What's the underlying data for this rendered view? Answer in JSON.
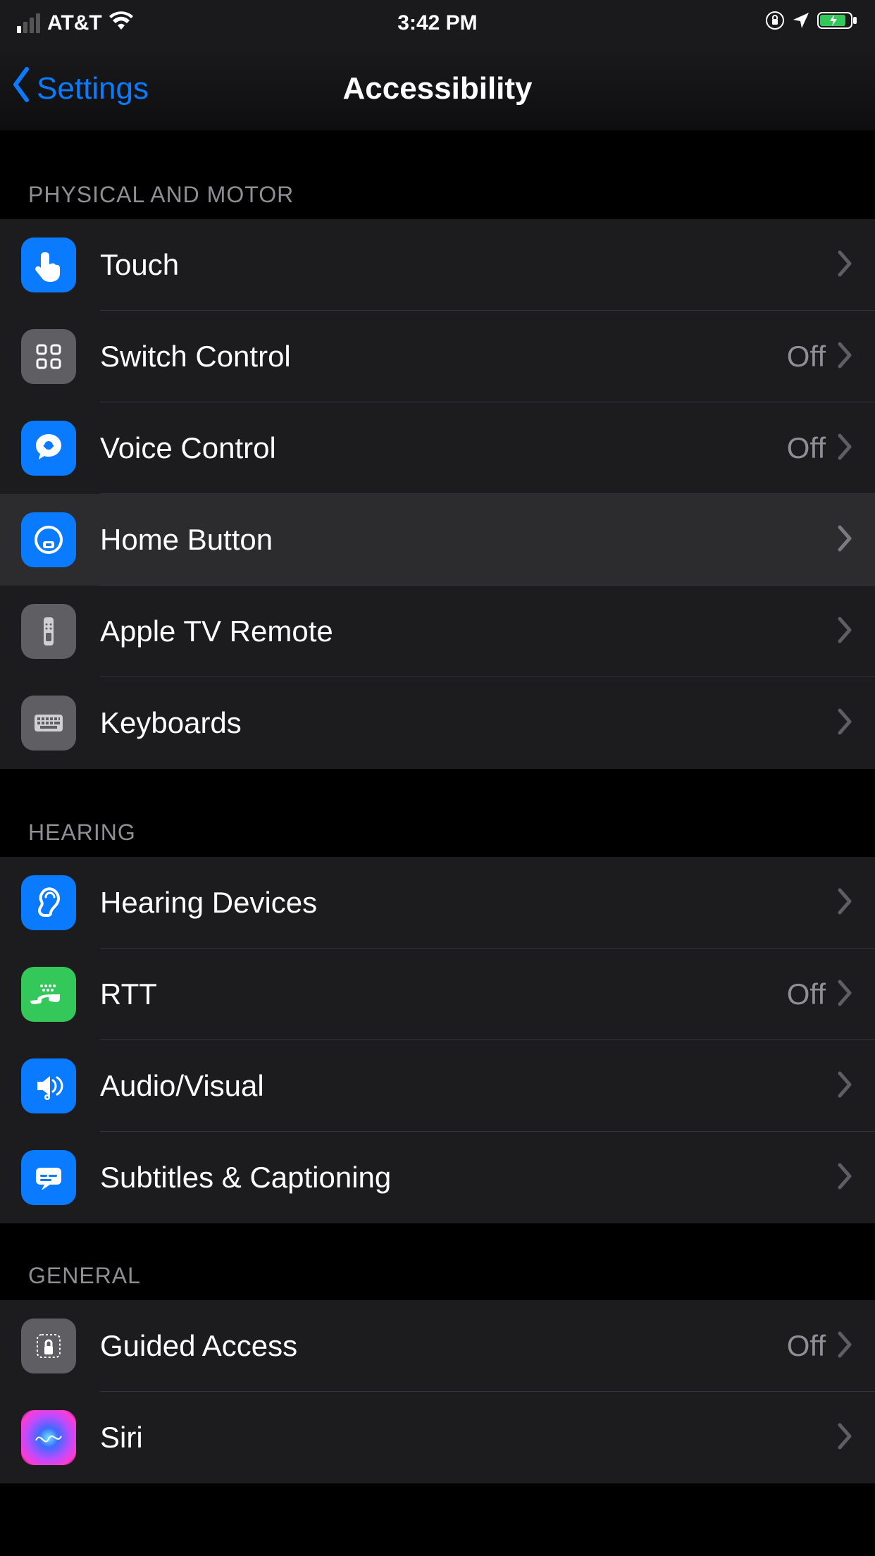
{
  "status": {
    "carrier": "AT&T",
    "time": "3:42 PM"
  },
  "nav": {
    "back": "Settings",
    "title": "Accessibility"
  },
  "sections": {
    "physical": {
      "header": "Physical and Motor",
      "touch": "Touch",
      "switch_control": "Switch Control",
      "switch_control_value": "Off",
      "voice_control": "Voice Control",
      "voice_control_value": "Off",
      "home_button": "Home Button",
      "apple_tv_remote": "Apple TV Remote",
      "keyboards": "Keyboards"
    },
    "hearing": {
      "header": "Hearing",
      "hearing_devices": "Hearing Devices",
      "rtt": "RTT",
      "rtt_value": "Off",
      "audio_visual": "Audio/Visual",
      "subtitles": "Subtitles & Captioning"
    },
    "general": {
      "header": "General",
      "guided_access": "Guided Access",
      "guided_access_value": "Off",
      "siri": "Siri"
    }
  }
}
